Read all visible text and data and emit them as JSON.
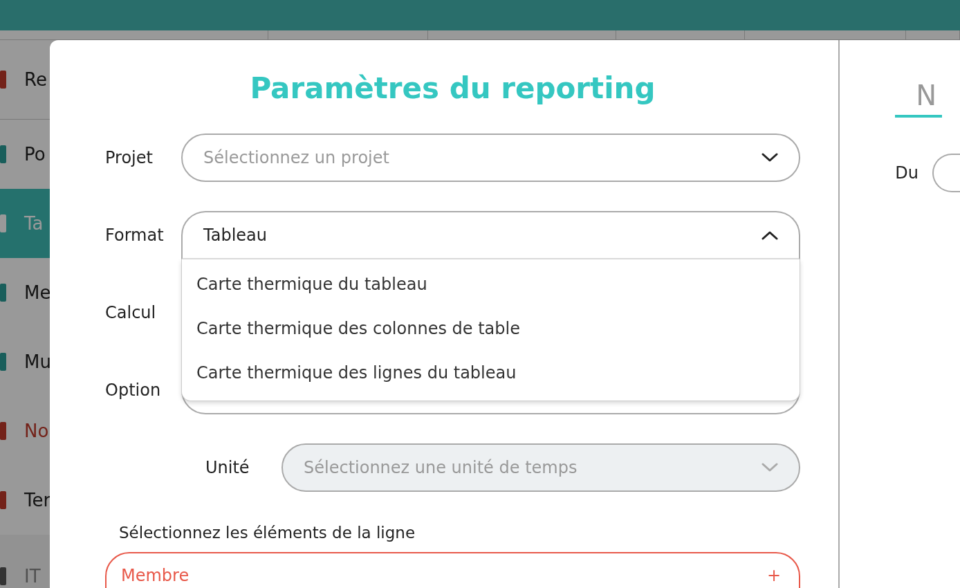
{
  "sidebar": {
    "items": [
      {
        "label": "Re",
        "selected": false,
        "kind": "warning"
      },
      {
        "label": "Po",
        "selected": false,
        "kind": "normal"
      },
      {
        "label": "Ta",
        "selected": true,
        "kind": "normal"
      },
      {
        "label": "Me",
        "selected": false,
        "kind": "normal"
      },
      {
        "label": "Mu",
        "selected": false,
        "kind": "normal"
      },
      {
        "label": "No",
        "selected": false,
        "kind": "alert"
      },
      {
        "label": "Ter",
        "selected": false,
        "kind": "warning"
      },
      {
        "label": "IT",
        "selected": false,
        "kind": "muted"
      }
    ]
  },
  "modal": {
    "title": "Paramètres du reporting",
    "fields": [
      {
        "label": "Projet",
        "kind": "select",
        "placeholder": "Sélectionnez un projet",
        "expanded": false,
        "disabled": false
      },
      {
        "label": "Format",
        "kind": "select",
        "value": "Tableau",
        "expanded": true,
        "disabled": false,
        "options": [
          "Carte thermique du tableau",
          "Carte thermique des colonnes de table",
          "Carte thermique des lignes du tableau"
        ]
      },
      {
        "label": "Calcul",
        "kind": "hidden"
      },
      {
        "label": "Option",
        "kind": "covered"
      },
      {
        "label": "Unité",
        "kind": "select",
        "placeholder": "Sélectionnez une unité de temps",
        "expanded": false,
        "disabled": true,
        "indent": true
      }
    ],
    "row_section": {
      "title": "Sélectionnez les éléments de la ligne",
      "item": {
        "label": "Membre",
        "action": "+"
      }
    }
  },
  "side_panel": {
    "tab": {
      "label": "N",
      "selected": true
    },
    "date_label": "Du"
  }
}
